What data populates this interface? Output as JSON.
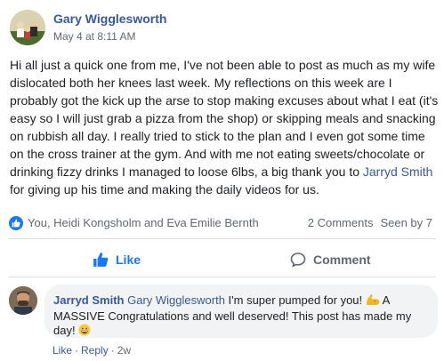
{
  "post": {
    "author": "Gary Wigglesworth",
    "timestamp": "May 4 at 8:11 AM",
    "body_part1": "Hi all just a quick one from me, I've not been able to post as much as my wife dislocated both her knees last week. My reflections on this week are I probably got the kick up the arse to stop making excuses about what I eat (it's easy so I will just grab a pizza from the shop) or skipping meals and snacking on rubbish all day. I really tried to stick to the plan and I even got some time on the cross trainer at the gym. And with me not eating sweets/chocolate or drinking fizzy drinks I managed to loose 6lbs, a big thank you to ",
    "body_mention": "Jarryd Smith",
    "body_part2": " for giving up his time and making the daily videos for us."
  },
  "reactions": {
    "names": "You, Heidi Kongsholm and Eva Emilie Bernth",
    "comments": "2 Comments",
    "seen": "Seen by 7"
  },
  "actions": {
    "like_label": "Like",
    "comment_label": "Comment"
  },
  "comment": {
    "author": "Jarryd Smith",
    "mention": "Gary Wigglesworth",
    "text_part1": " I'm super pumped for you! ",
    "text_part2": " A MASSIVE Congratulations and well deserved! This post has made my day! ",
    "like_label": "Like",
    "reply_label": "Reply",
    "age": "2w"
  },
  "colors": {
    "link": "#385898",
    "accent": "#1877f2",
    "muted": "#606770",
    "bubble": "#f2f3f5"
  },
  "icons": [
    "avatar-photo",
    "like-thumb-icon",
    "comment-icon",
    "flexed-biceps-emoji",
    "grinning-emoji"
  ]
}
